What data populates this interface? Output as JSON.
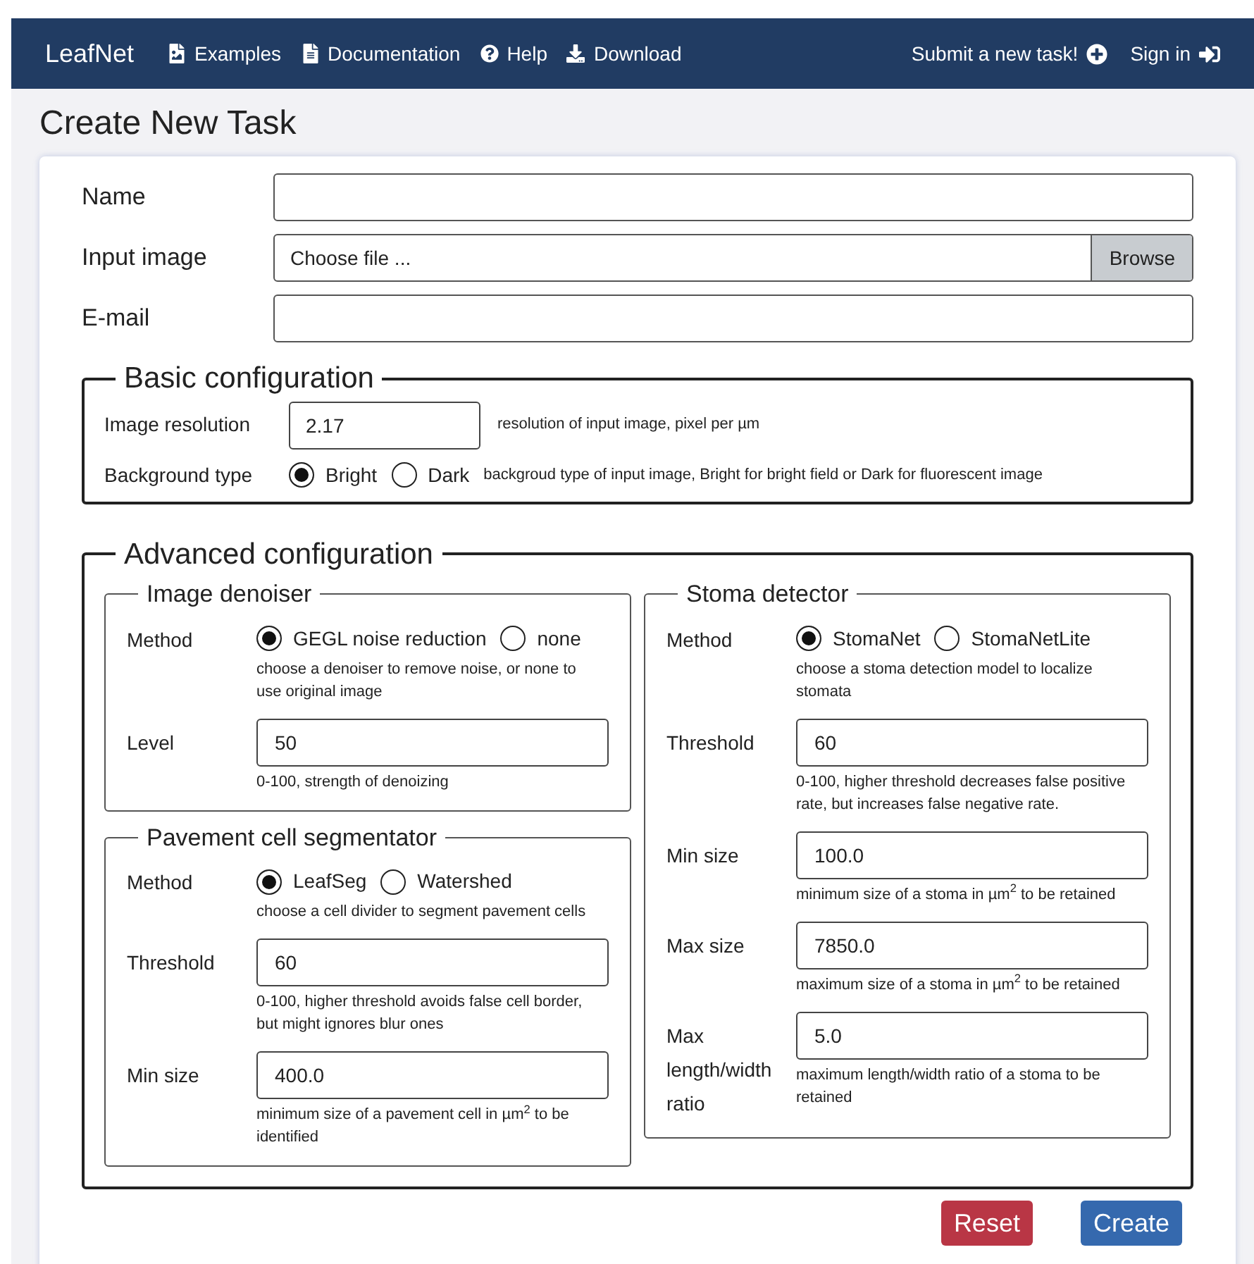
{
  "navbar": {
    "brand": "LeafNet",
    "links": [
      {
        "label": "Examples",
        "kind": "image-file"
      },
      {
        "label": "Documentation",
        "kind": "text-file"
      },
      {
        "label": "Help",
        "kind": "question"
      },
      {
        "label": "Download",
        "kind": "download"
      }
    ],
    "right_links": [
      {
        "label": "Submit a new task!",
        "kind": "plus"
      },
      {
        "label": "Sign in",
        "kind": "sign-in"
      }
    ]
  },
  "title": "Create New Task",
  "fields": [
    {
      "label": "Name",
      "kind": "text"
    },
    {
      "label": "Input image",
      "kind": "file",
      "placeholder": "Choose file ...",
      "button": "Browse"
    },
    {
      "label": "E-mail",
      "kind": "text"
    }
  ],
  "basic": {
    "title": "Basic configuration",
    "rows": [
      {
        "label": "Image resolution",
        "kind": "input",
        "value": "2.17",
        "hint": "resolution of input image, pixel per µm"
      },
      {
        "label": "Background type",
        "kind": "radio",
        "options": [
          {
            "label": "Bright",
            "selected": true
          },
          {
            "label": "Dark",
            "selected": false
          }
        ],
        "hint": "backgroud type of input image, Bright for bright field or Dark for fluorescent image"
      }
    ]
  },
  "advanced": {
    "title": "Advanced configuration",
    "columns": [
      [
        {
          "title": "Image denoiser",
          "rows": [
            {
              "label": "Method",
              "kind": "radio",
              "options": [
                {
                  "label": "GEGL noise reduction",
                  "selected": true
                },
                {
                  "label": "none",
                  "selected": false
                }
              ],
              "hint": "choose a denoiser to remove noise, or none to use original image"
            },
            {
              "label": "Level",
              "kind": "input",
              "value": "50",
              "hint": "0-100, strength of denoizing"
            }
          ]
        },
        {
          "title": "Pavement cell segmentator",
          "rows": [
            {
              "label": "Method",
              "kind": "radio",
              "options": [
                {
                  "label": "LeafSeg",
                  "selected": true
                },
                {
                  "label": "Watershed",
                  "selected": false
                }
              ],
              "hint": "choose a cell divider to segment pavement cells"
            },
            {
              "label": "Threshold",
              "kind": "input",
              "value": "60",
              "hint": "0-100, higher threshold avoids false cell border, but might ignores blur ones"
            },
            {
              "label": "Min size",
              "kind": "input",
              "value": "400.0",
              "hint": "minimum size of a pavement cell in µm$^{2}$ to be identified"
            }
          ]
        }
      ],
      [
        {
          "title": "Stoma detector",
          "rows": [
            {
              "label": "Method",
              "kind": "radio",
              "options": [
                {
                  "label": "StomaNet",
                  "selected": true
                },
                {
                  "label": "StomaNetLite",
                  "selected": false
                }
              ],
              "hint": "choose a stoma detection model to localize stomata"
            },
            {
              "label": "Threshold",
              "kind": "input",
              "value": "60",
              "hint": "0-100, higher threshold decreases false positive rate, but increases false negative rate."
            },
            {
              "label": "Min size",
              "kind": "input",
              "value": "100.0",
              "hint": "minimum size of a stoma in µm$^{2}$ to be retained"
            },
            {
              "label": "Max size",
              "kind": "input",
              "value": "7850.0",
              "hint": "maximum size of a stoma in µm$^{2}$ to be retained"
            },
            {
              "label": "Max length/width ratio",
              "kind": "input",
              "value": "5.0",
              "hint": "maximum length/width ratio of a stoma to be retained"
            }
          ]
        }
      ]
    ]
  },
  "buttons": [
    {
      "label": "Reset",
      "kind": "reset"
    },
    {
      "label": "Create",
      "kind": "submit"
    }
  ]
}
